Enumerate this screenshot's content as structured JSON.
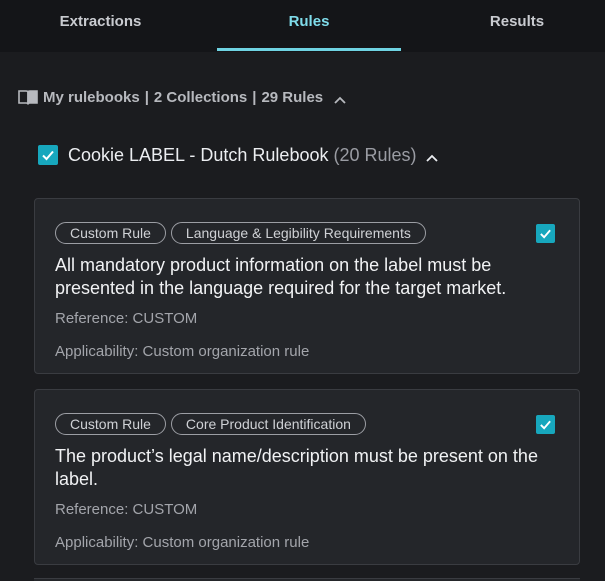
{
  "tabs": [
    {
      "label": "Extractions",
      "active": false
    },
    {
      "label": "Rules",
      "active": true
    },
    {
      "label": "Results",
      "active": false
    }
  ],
  "rulebooks": {
    "title": "My rulebooks",
    "collections": "2 Collections",
    "rules": "29 Rules",
    "icon": "book-icon",
    "expanded": true
  },
  "collection": {
    "title": "Cookie LABEL - Dutch Rulebook",
    "count": "(20 Rules)",
    "checked": true,
    "expanded": true
  },
  "rules": [
    {
      "tags": [
        "Custom Rule",
        "Language & Legibility Requirements"
      ],
      "description": "All mandatory product information on the label must be presented in the language required for the target market.",
      "reference": "Reference: CUSTOM",
      "applicability": "Applicability: Custom organization rule",
      "checked": true
    },
    {
      "tags": [
        "Custom Rule",
        "Core Product Identification"
      ],
      "description": "The product’s legal name/description must be present on the label.",
      "reference": "Reference: CUSTOM",
      "applicability": "Applicability: Custom organization rule",
      "checked": true
    }
  ],
  "colors": {
    "accent": "#17a7bd",
    "active_tab": "#7fdcea",
    "background": "#1b1c1f",
    "card": "#24262a"
  }
}
